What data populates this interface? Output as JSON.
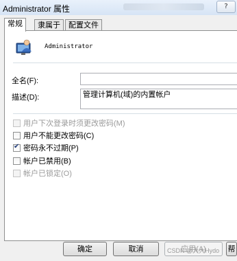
{
  "window": {
    "title": "Administrator 属性",
    "help_glyph": "?"
  },
  "tabs": [
    {
      "label": "常规",
      "active": true
    },
    {
      "label": "隶属于",
      "active": false
    },
    {
      "label": "配置文件",
      "active": false
    }
  ],
  "user": {
    "name": "Administrator",
    "icon": "user-monitor-icon"
  },
  "fields": [
    {
      "label": "全名(F):",
      "value": ""
    },
    {
      "label": "描述(D):",
      "value": "管理计算机(域)的内置帐户"
    }
  ],
  "options": [
    {
      "label": "用户下次登录时须更改密码(M)",
      "checked": false,
      "enabled": false
    },
    {
      "label": "用户不能更改密码(C)",
      "checked": false,
      "enabled": true
    },
    {
      "label": "密码永不过期(P)",
      "checked": true,
      "enabled": true
    },
    {
      "label": "帐户已禁用(B)",
      "checked": false,
      "enabled": true
    },
    {
      "label": "帐户已锁定(O)",
      "checked": false,
      "enabled": false
    }
  ],
  "buttons": {
    "ok": "确定",
    "cancel": "取消",
    "apply": "应用(A)",
    "help": "帮"
  },
  "watermark": "CSDN @大大Hydo"
}
